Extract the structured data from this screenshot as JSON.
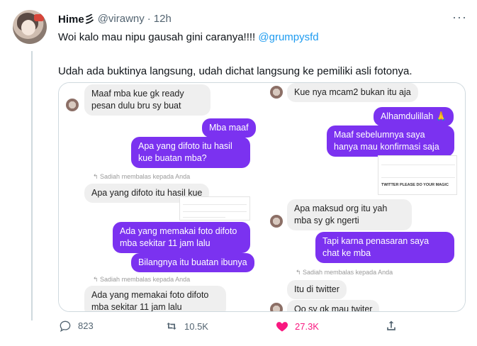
{
  "tweet": {
    "author_name": "Hime",
    "author_emoji": "彡",
    "handle": "@virawny",
    "separator": "·",
    "time": "12h",
    "line1_text": "Woi kalo mau nipu gausah gini caranya!!!! ",
    "line1_mention": "@grumpysfd",
    "line2_text": "Udah ada buktinya langsung, udah dichat langsung ke pemiliki asli fotonya.",
    "more_label": "···"
  },
  "chat_left": {
    "msg1": "Maaf mba kue gk ready pesan dulu bru sy buat",
    "msg2": "Mba maaf",
    "msg3": "Apa yang difoto itu hasil kue buatan mba?",
    "reply_note1": "↰ Sadiah membalas kepada Anda",
    "msg4": "Apa yang difoto itu hasil kue",
    "msg5": "Ada yang memakai foto difoto mba sekitar 11 jam lalu",
    "msg6": "Bilangnya itu buatan ibunya",
    "reply_note2": "↰ Sadiah membalas kepada Anda",
    "msg7": "Ada yang memakai foto difoto mba sekitar 11 jam lalu"
  },
  "chat_right": {
    "msg1": "Kue nya mcam2 bukan itu aja",
    "msg2": "Alhamdulillah 🙏",
    "msg3": "Maaf sebelumnya saya hanya mau konfirmasi saja",
    "shot_caption": "TWITTER PLEASE DO YOUR MAGIC",
    "msg4": "Apa maksud org itu yah mba sy gk ngerti",
    "msg5": "Tapi karna penasaran saya chat ke mba",
    "reply_note": "↰ Sadiah membalas kepada Anda",
    "msg6": "Itu di twitter",
    "msg7": "Oo sy gk mau twiter"
  },
  "actions": {
    "replies": "823",
    "retweets": "10.5K",
    "likes": "27.3K"
  },
  "colors": {
    "accent": "#1d9bf0",
    "like": "#f91880",
    "chat_bubble_out": "#7b32f0",
    "muted": "#536471"
  }
}
